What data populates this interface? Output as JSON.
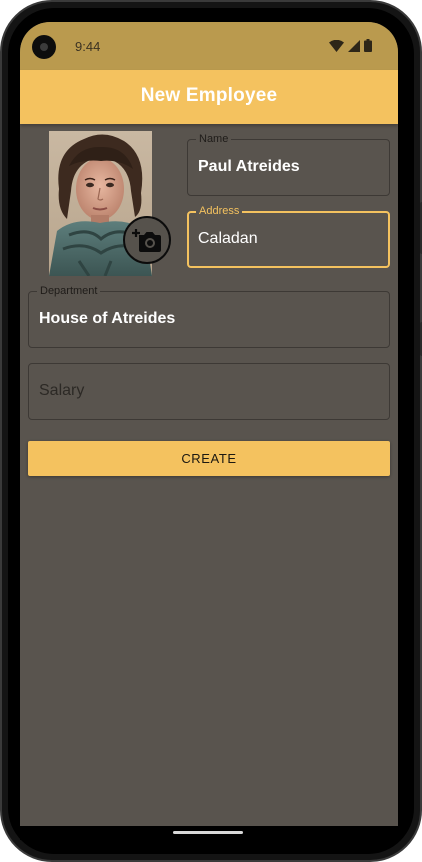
{
  "status_bar": {
    "time": "9:44",
    "icons": [
      "wifi-icon",
      "signal-icon",
      "battery-icon"
    ]
  },
  "app_bar": {
    "title": "New Employee"
  },
  "photo": {
    "alt": "employee-photo",
    "camera_icon": "add-photo-icon"
  },
  "form": {
    "name": {
      "label": "Name",
      "value": "Paul Atreides"
    },
    "address": {
      "label": "Address",
      "value": "Caladan"
    },
    "department": {
      "label": "Department",
      "value": "House of Atreides"
    },
    "salary": {
      "placeholder": "Salary"
    },
    "create_label": "CREATE"
  },
  "colors": {
    "accent": "#f4c25f",
    "status_bar": "#ba9a4e",
    "background": "#59544e"
  }
}
